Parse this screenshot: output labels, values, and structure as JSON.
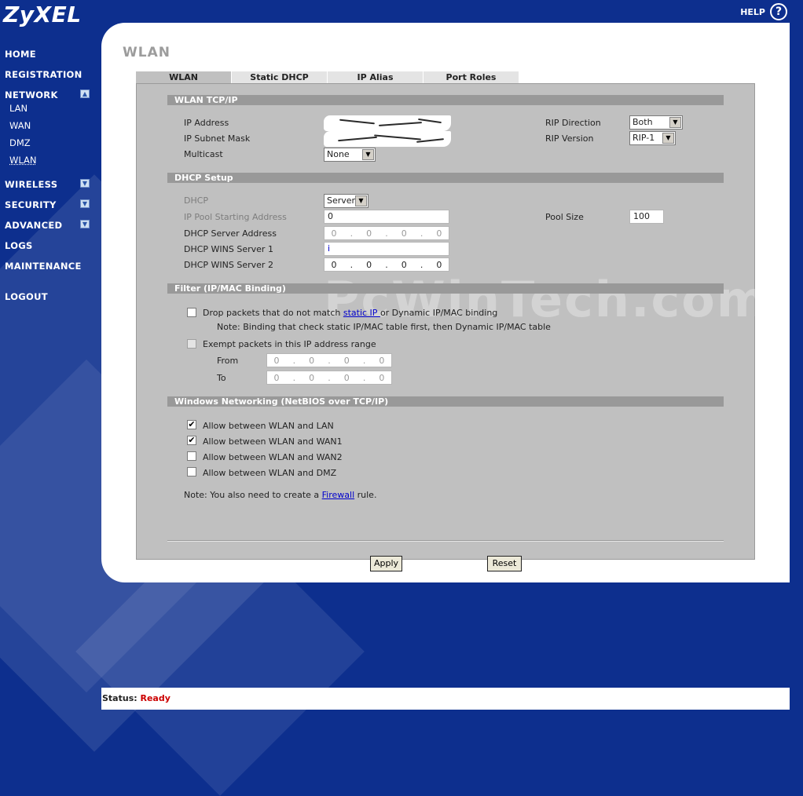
{
  "header": {
    "logo": "ZyXEL",
    "help_label": "HELP",
    "help_icon": "?"
  },
  "nav": {
    "home": "HOME",
    "registration": "REGISTRATION",
    "network": "NETWORK",
    "network_subitems": [
      "LAN",
      "WAN",
      "DMZ",
      "WLAN"
    ],
    "wireless": "WIRELESS",
    "security": "SECURITY",
    "advanced": "ADVANCED",
    "logs": "LOGS",
    "maintenance": "MAINTENANCE",
    "logout": "LOGOUT",
    "toggle_collapse_icon": "chevron-up-icon",
    "toggle_expand_icon": "chevron-down-icon"
  },
  "page": {
    "title": "WLAN"
  },
  "tabs": [
    "WLAN",
    "Static DHCP",
    "IP Alias",
    "Port Roles"
  ],
  "tcpip": {
    "section": "WLAN TCP/IP",
    "ip_address_label": "IP Address",
    "subnet_mask_label": "IP Subnet Mask",
    "multicast_label": "Multicast",
    "multicast_value": "None",
    "rip_direction_label": "RIP Direction",
    "rip_direction_value": "Both",
    "rip_version_label": "RIP Version",
    "rip_version_value": "RIP-1"
  },
  "dhcp": {
    "section": "DHCP Setup",
    "dhcp_label": "DHCP",
    "dhcp_value": "Server",
    "pool_start_label": "IP Pool Starting Address",
    "pool_start_value": "0",
    "pool_size_label": "Pool Size",
    "pool_size_value": "100",
    "server_address_label": "DHCP Server Address",
    "server_address_octets": [
      "0",
      "0",
      "0",
      "0"
    ],
    "wins1_label": "DHCP WINS Server 1",
    "wins1_value": "i",
    "wins2_label": "DHCP WINS Server 2",
    "wins2_octets": [
      "0",
      "0",
      "0",
      "0"
    ]
  },
  "filter": {
    "section": "Filter (IP/MAC Binding)",
    "drop_prefix": "Drop packets that do not match ",
    "drop_link": "static IP ",
    "drop_suffix": "or Dynamic IP/MAC binding",
    "note": "Note: Binding that check static IP/MAC table first, then Dynamic IP/MAC table",
    "exempt_label": "Exempt packets in this IP address range",
    "from_label": "From",
    "from_octets": [
      "0",
      "0",
      "0",
      "0"
    ],
    "to_label": "To",
    "to_octets": [
      "0",
      "0",
      "0",
      "0"
    ]
  },
  "netbios": {
    "section": "Windows Networking (NetBIOS over TCP/IP)",
    "options": [
      {
        "label": "Allow between WLAN and LAN",
        "checked": "✔"
      },
      {
        "label": "Allow between WLAN and WAN1",
        "checked": "✔"
      },
      {
        "label": "Allow between WLAN and WAN2",
        "checked": ""
      },
      {
        "label": "Allow between WLAN and DMZ",
        "checked": ""
      }
    ],
    "note_prefix": "Note: You also need to create a ",
    "note_link": "Firewall",
    "note_suffix": " rule."
  },
  "buttons": {
    "apply": "Apply",
    "reset": "Reset"
  },
  "status": {
    "label": "Status:",
    "value": "Ready"
  },
  "watermark": "PcWinTech.com",
  "colors": {
    "background": "#0d2f8e",
    "section_bar": "#999999",
    "status_ready": "#cc0000",
    "link": "#0000cc"
  }
}
